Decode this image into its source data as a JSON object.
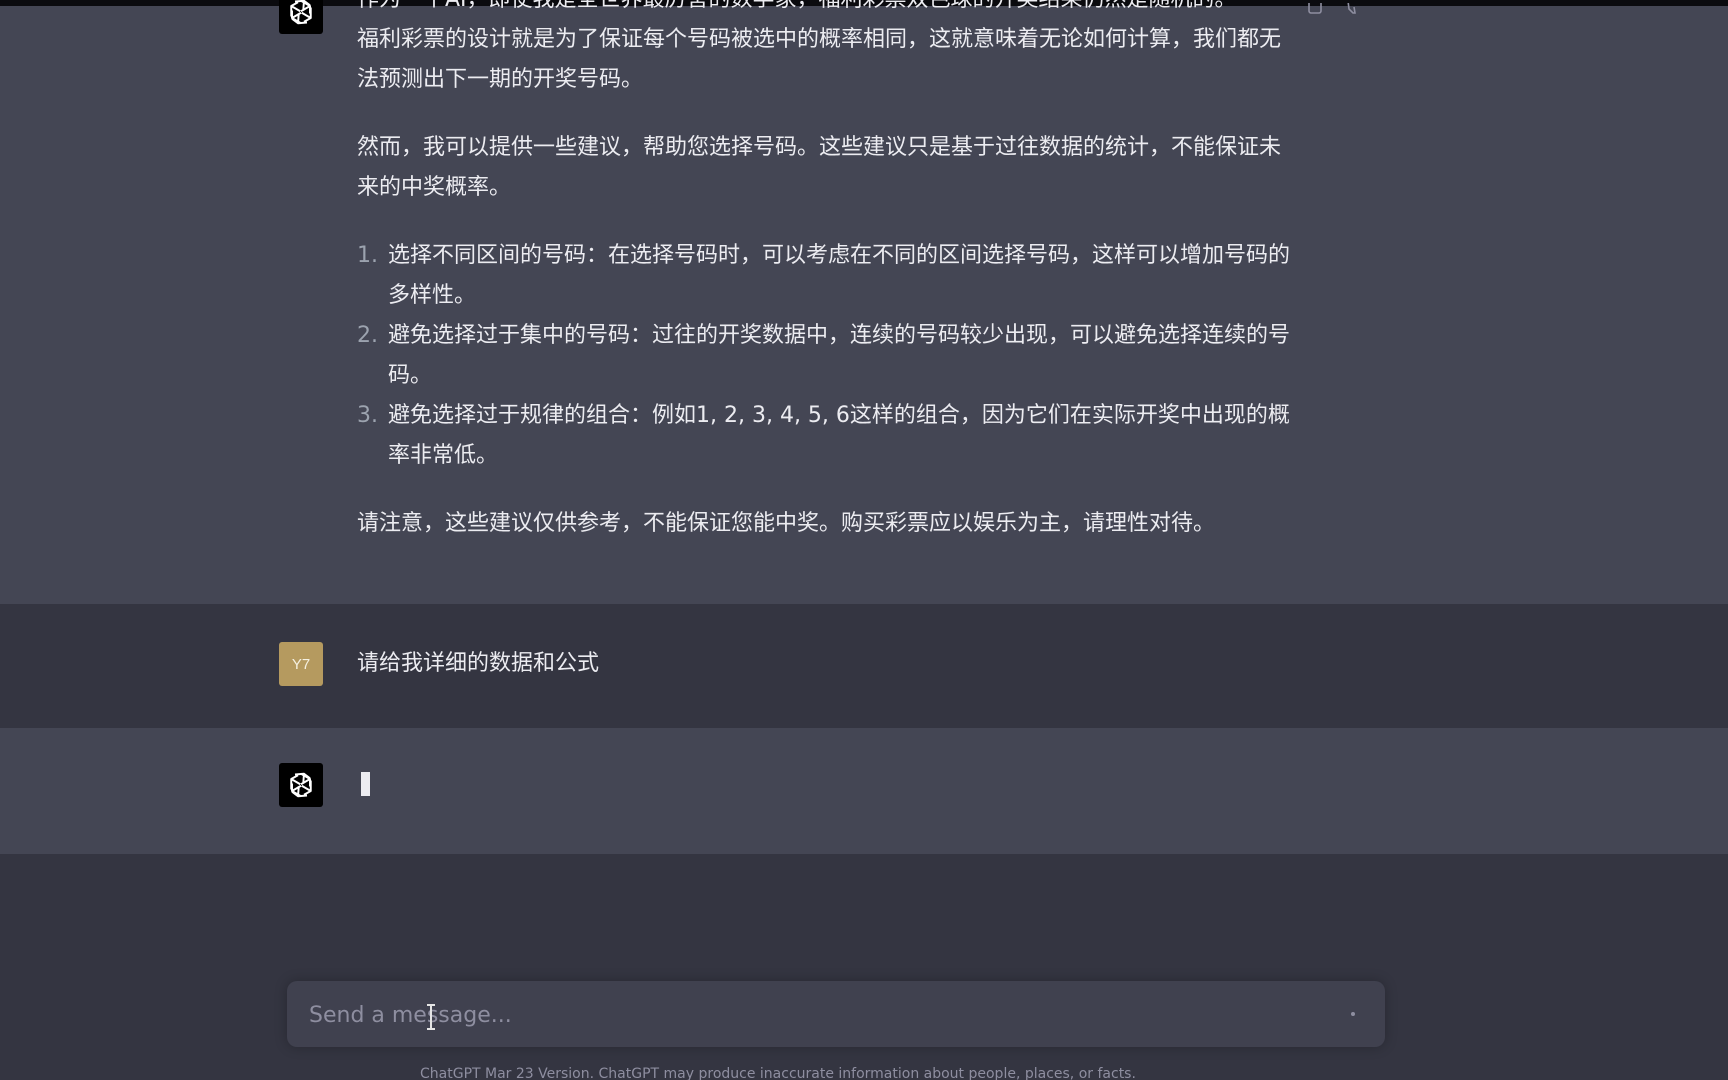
{
  "conversation": {
    "assistant_message_1": {
      "line_top_partial": "作为一个AI，即使我是全世界最厉害的数学家，福利彩票双色球的开奖结果仍然是随机的。",
      "para1": "福利彩票的设计就是为了保证每个号码被选中的概率相同，这就意味着无论如何计算，我们都无法预测出下一期的开奖号码。",
      "para2": "然而，我可以提供一些建议，帮助您选择号码。这些建议只是基于过往数据的统计，不能保证未来的中奖概率。",
      "tips": [
        {
          "num": "1.",
          "text": "选择不同区间的号码：在选择号码时，可以考虑在不同的区间选择号码，这样可以增加号码的多样性。"
        },
        {
          "num": "2.",
          "text": "避免选择过于集中的号码：过往的开奖数据中，连续的号码较少出现，可以避免选择连续的号码。"
        },
        {
          "num": "3.",
          "text": "避免选择过于规律的组合：例如1, 2, 3, 4, 5, 6这样的组合，因为它们在实际开奖中出现的概率非常低。"
        }
      ],
      "para3": "请注意，这些建议仅供参考，不能保证您能中奖。购买彩票应以娱乐为主，请理性对待。"
    },
    "user_message": {
      "avatar_label": "Y7",
      "text": "请给我详细的数据和公式"
    }
  },
  "composer": {
    "placeholder": "Send a message..."
  },
  "footer": {
    "note": "ChatGPT Mar 23 Version. ChatGPT may produce inaccurate information about people, places, or facts."
  }
}
